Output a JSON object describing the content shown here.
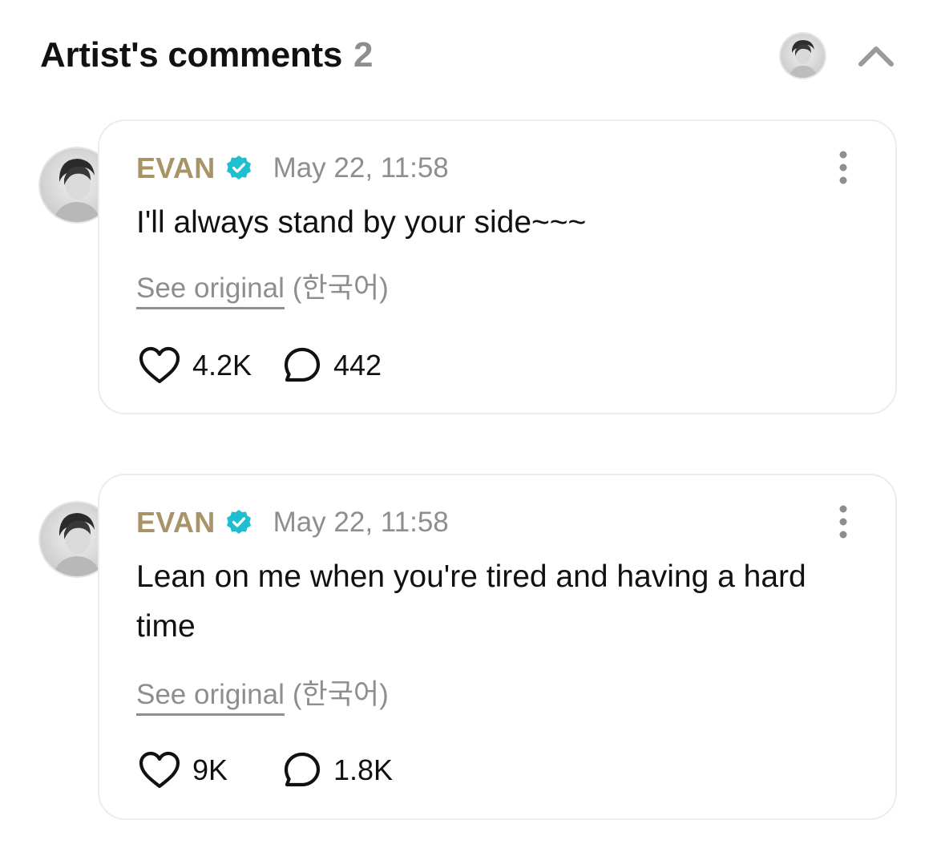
{
  "header": {
    "title": "Artist's comments",
    "count": "2",
    "avatar_icon": "artist-avatar",
    "collapse_icon": "chevron-up-icon"
  },
  "colors": {
    "author": "#a99468",
    "verified": "#1fbfcf",
    "muted": "#8e8e8e",
    "border": "#ececec"
  },
  "comments": [
    {
      "author": "EVAN",
      "verified_icon": "verified-badge-icon",
      "timestamp": "May 22, 11:58",
      "text": "I'll always stand by your side~~~",
      "see_original": "See original",
      "language": "(한국어)",
      "likes": "4.2K",
      "replies": "442"
    },
    {
      "author": "EVAN",
      "verified_icon": "verified-badge-icon",
      "timestamp": "May 22, 11:58",
      "text": "Lean on me when you're tired and having a hard time",
      "see_original": "See original",
      "language": "(한국어)",
      "likes": "9K",
      "replies": "1.8K"
    }
  ]
}
